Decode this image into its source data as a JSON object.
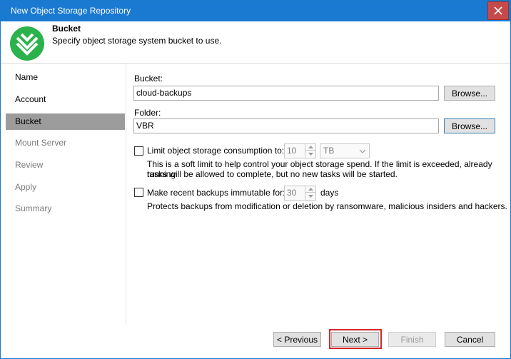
{
  "window": {
    "title": "New Object Storage Repository"
  },
  "header": {
    "title": "Bucket",
    "subtitle": "Specify object storage system bucket to use."
  },
  "sidebar": {
    "items": [
      {
        "label": "Name",
        "state": "normal"
      },
      {
        "label": "Account",
        "state": "normal"
      },
      {
        "label": "Bucket",
        "state": "active"
      },
      {
        "label": "Mount Server",
        "state": "disabled"
      },
      {
        "label": "Review",
        "state": "disabled"
      },
      {
        "label": "Apply",
        "state": "disabled"
      },
      {
        "label": "Summary",
        "state": "disabled"
      }
    ]
  },
  "form": {
    "bucket_label": "Bucket:",
    "bucket_value": "cloud-backups",
    "bucket_browse": "Browse...",
    "folder_label": "Folder:",
    "folder_value": "VBR",
    "folder_browse": "Browse...",
    "limit_label": "Limit object storage consumption to:",
    "limit_value": "10",
    "limit_unit": "TB",
    "limit_note_line1": "This is a soft limit to help control your object storage spend. If the limit is exceeded, already running",
    "limit_note_line2": "tasks will be allowed to complete, but no new tasks will be started.",
    "immutable_label": "Make recent backups immutable for:",
    "immutable_value": "30",
    "immutable_unit": "days",
    "immutable_note": "Protects backups from modification or deletion by ransomware, malicious insiders and hackers."
  },
  "footer": {
    "previous": "< Previous",
    "next": "Next >",
    "finish": "Finish",
    "cancel": "Cancel"
  },
  "colors": {
    "titlebar": "#1a7ad1",
    "logo_green": "#2bb24c",
    "highlight": "#d12a2a"
  }
}
